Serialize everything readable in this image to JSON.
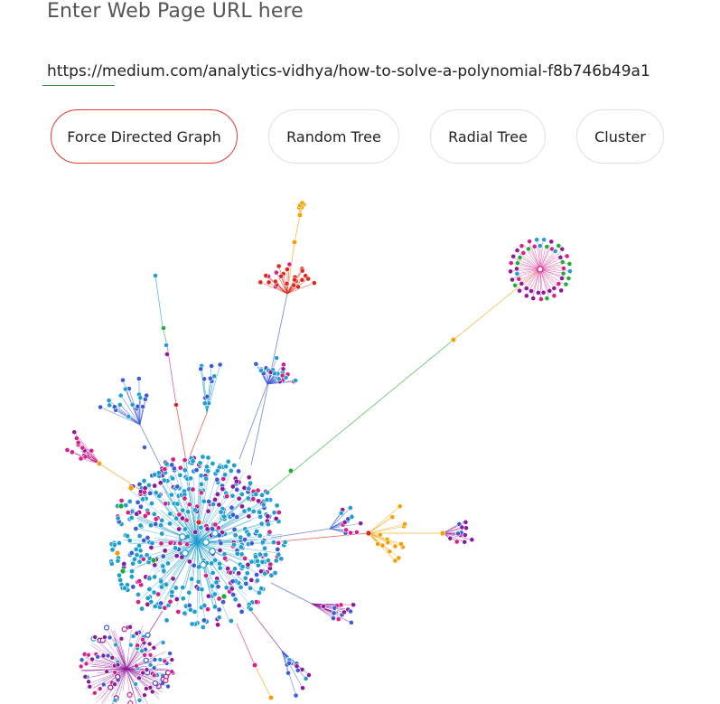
{
  "header": {
    "title": "Enter Web Page URL here"
  },
  "url_input": {
    "value": "https://medium.com/analytics-vidhya/how-to-solve-a-polynomial-f8b746b49a1"
  },
  "layout_buttons": [
    {
      "label": "Force Directed Graph",
      "active": true
    },
    {
      "label": "Random Tree",
      "active": false
    },
    {
      "label": "Radial Tree",
      "active": false
    },
    {
      "label": "Cluster",
      "active": false
    }
  ],
  "graph": {
    "type": "force-directed network",
    "colors": {
      "blue": "#1f9fd0",
      "darkblue": "#3b5bd9",
      "purple": "#8e1a9b",
      "magenta": "#d6208a",
      "red": "#e32619",
      "orange": "#f5a000",
      "green": "#1fae34",
      "active_border": "#e53935",
      "url_underline": "#2e7d32"
    }
  }
}
